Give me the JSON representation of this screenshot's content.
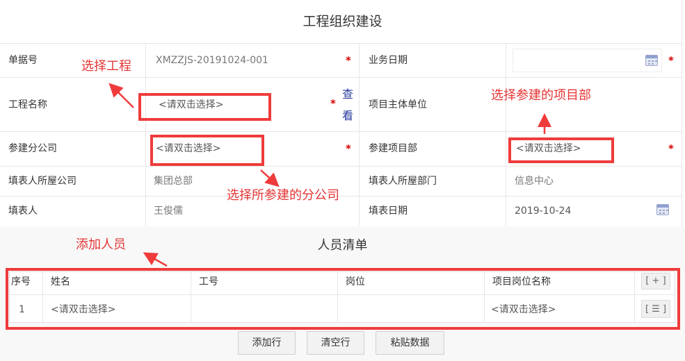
{
  "page": {
    "title": "工程组织建设"
  },
  "form": {
    "doc_no": {
      "label": "单据号",
      "value": "XMZZJS-20191024-001",
      "required": "*"
    },
    "biz_date": {
      "label": "业务日期",
      "value": "",
      "required": "*"
    },
    "project_name": {
      "label": "工程名称",
      "placeholder": "<请双击选择>",
      "required": "*",
      "view_link": "查看",
      "view_link_line1": "查",
      "view_link_line2": "看"
    },
    "project_owner": {
      "label": "项目主体单位",
      "value": ""
    },
    "branch_company": {
      "label": "参建分公司",
      "placeholder": "<请双击选择>",
      "required": "*"
    },
    "project_dept": {
      "label": "参建项目部",
      "placeholder": "<请双击选择>",
      "required": "*"
    },
    "filler_company": {
      "label": "填表人所屋公司",
      "value": "集团总部"
    },
    "filler_dept": {
      "label": "填表人所屋部门",
      "value": "信息中心"
    },
    "filler": {
      "label": "填表人",
      "value": "王俊儒"
    },
    "fill_date": {
      "label": "填表日期",
      "value": "2019-10-24"
    }
  },
  "annotations": {
    "select_project": "选择工程",
    "select_dept": "选择参建的项目部",
    "select_branch": "选择所参建的分公司",
    "add_people": "添加人员"
  },
  "personnel": {
    "title": "人员清单",
    "columns": [
      "序号",
      "姓名",
      "工号",
      "岗位",
      "项目岗位名称"
    ],
    "add_col_button": "[ + ]",
    "rows": [
      {
        "index": "1",
        "name": "<请双击选择>",
        "emp_no": "",
        "post": "",
        "project_post": "<请双击选择>",
        "row_button": "[ ☰ ]"
      }
    ]
  },
  "actions": {
    "add_row": "添加行",
    "clear_rows": "清空行",
    "paste_data": "粘贴数据"
  },
  "colors": {
    "annotation_red": "#ef3b3b",
    "required_red": "#d40000",
    "link_blue": "#2a3c9e"
  },
  "icons": {
    "calendar": "calendar-icon",
    "arrow": "arrow-icon"
  }
}
